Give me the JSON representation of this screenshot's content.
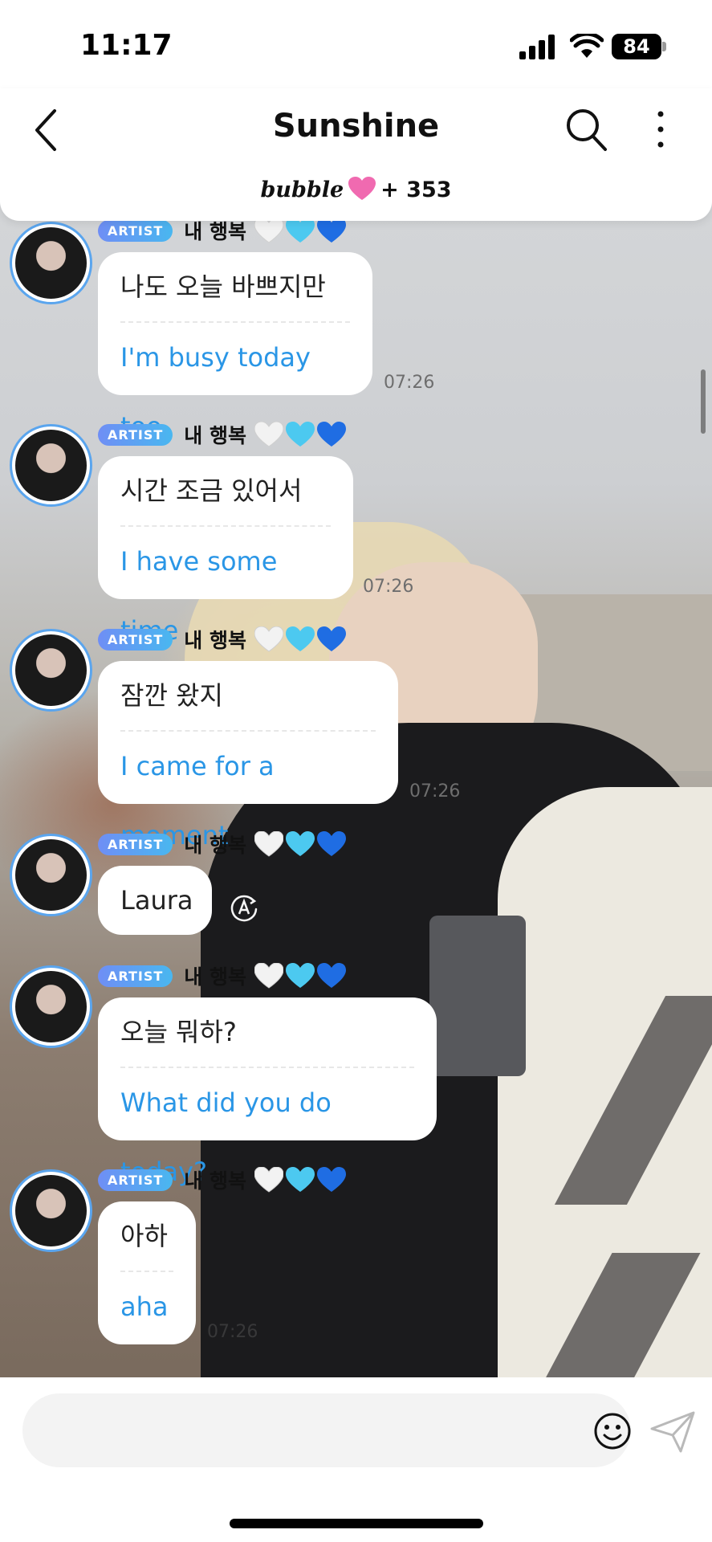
{
  "status_bar": {
    "time": "11:17",
    "battery": "84"
  },
  "header": {
    "title": "Sunshine",
    "brand": "bubble",
    "subscribers": "+ 353"
  },
  "messages": [
    {
      "badge": "ARTIST",
      "nickname": "내 행복",
      "original": "나도 오늘 바쁘지만",
      "translation": "I'm busy today too",
      "time": "07:26"
    },
    {
      "badge": "ARTIST",
      "nickname": "내 행복",
      "original": "시간 조금 있어서",
      "translation": "I have some time",
      "time": "07:26"
    },
    {
      "badge": "ARTIST",
      "nickname": "내 행복",
      "original": "잠깐 왔지",
      "translation": "I came for a moment",
      "time": "07:26"
    },
    {
      "badge": "ARTIST",
      "nickname": "내 행복",
      "original": "Laura"
    },
    {
      "badge": "ARTIST",
      "nickname": "내 행복",
      "original": "오늘 뭐하?",
      "translation": "What did you do today?"
    },
    {
      "badge": "ARTIST",
      "nickname": "내 행복",
      "original": "아하",
      "translation": "aha",
      "time": "07:26"
    }
  ],
  "hearts": [
    "white-heart",
    "light-blue-heart",
    "blue-heart"
  ],
  "colors": {
    "accent_blue": "#2a96e6",
    "badge_start": "#6f8ef5",
    "badge_end": "#49b7f0",
    "brand_pink": "#f06ab0"
  },
  "input": {
    "value": "",
    "placeholder": ""
  }
}
